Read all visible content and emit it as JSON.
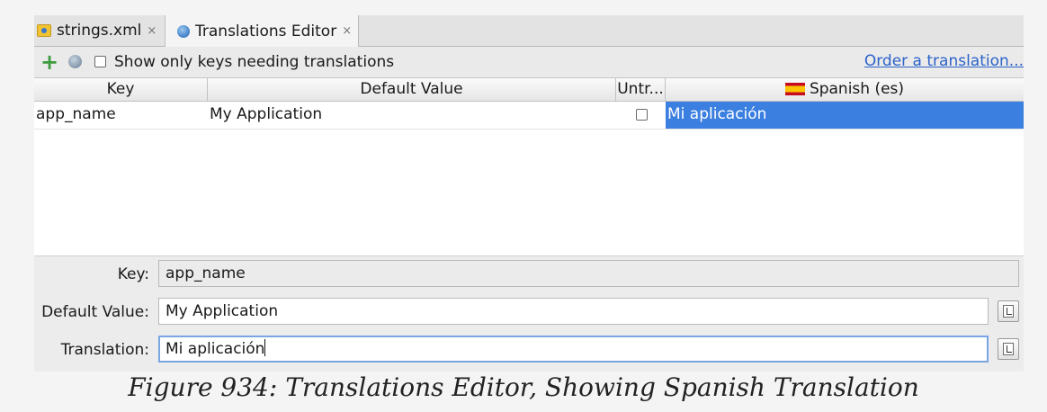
{
  "tabs": [
    {
      "label": "strings.xml",
      "close": "×"
    },
    {
      "label": "Translations Editor",
      "close": "×"
    }
  ],
  "toolbar": {
    "add_icon": "plus-icon",
    "globe_icon": "globe-icon",
    "filter_label": "Show only keys needing translations",
    "filter_checked": false,
    "order_link": "Order a translation..."
  },
  "table": {
    "columns": [
      "Key",
      "Default Value",
      "Untr...",
      "Spanish (es)"
    ],
    "rows": [
      {
        "key": "app_name",
        "default_value": "My Application",
        "untranslatable": false,
        "spanish": "Mi aplicación"
      }
    ]
  },
  "form": {
    "key_label": "Key:",
    "key_value": "app_name",
    "default_label": "Default Value:",
    "default_value": "My Application",
    "translation_label": "Translation:",
    "translation_value": "Mi aplicación"
  },
  "caption": "Figure 934: Translations Editor, Showing Spanish Translation",
  "colors": {
    "selection": "#3b7fe0",
    "link": "#2b62c9",
    "add": "#3d9b3d"
  }
}
